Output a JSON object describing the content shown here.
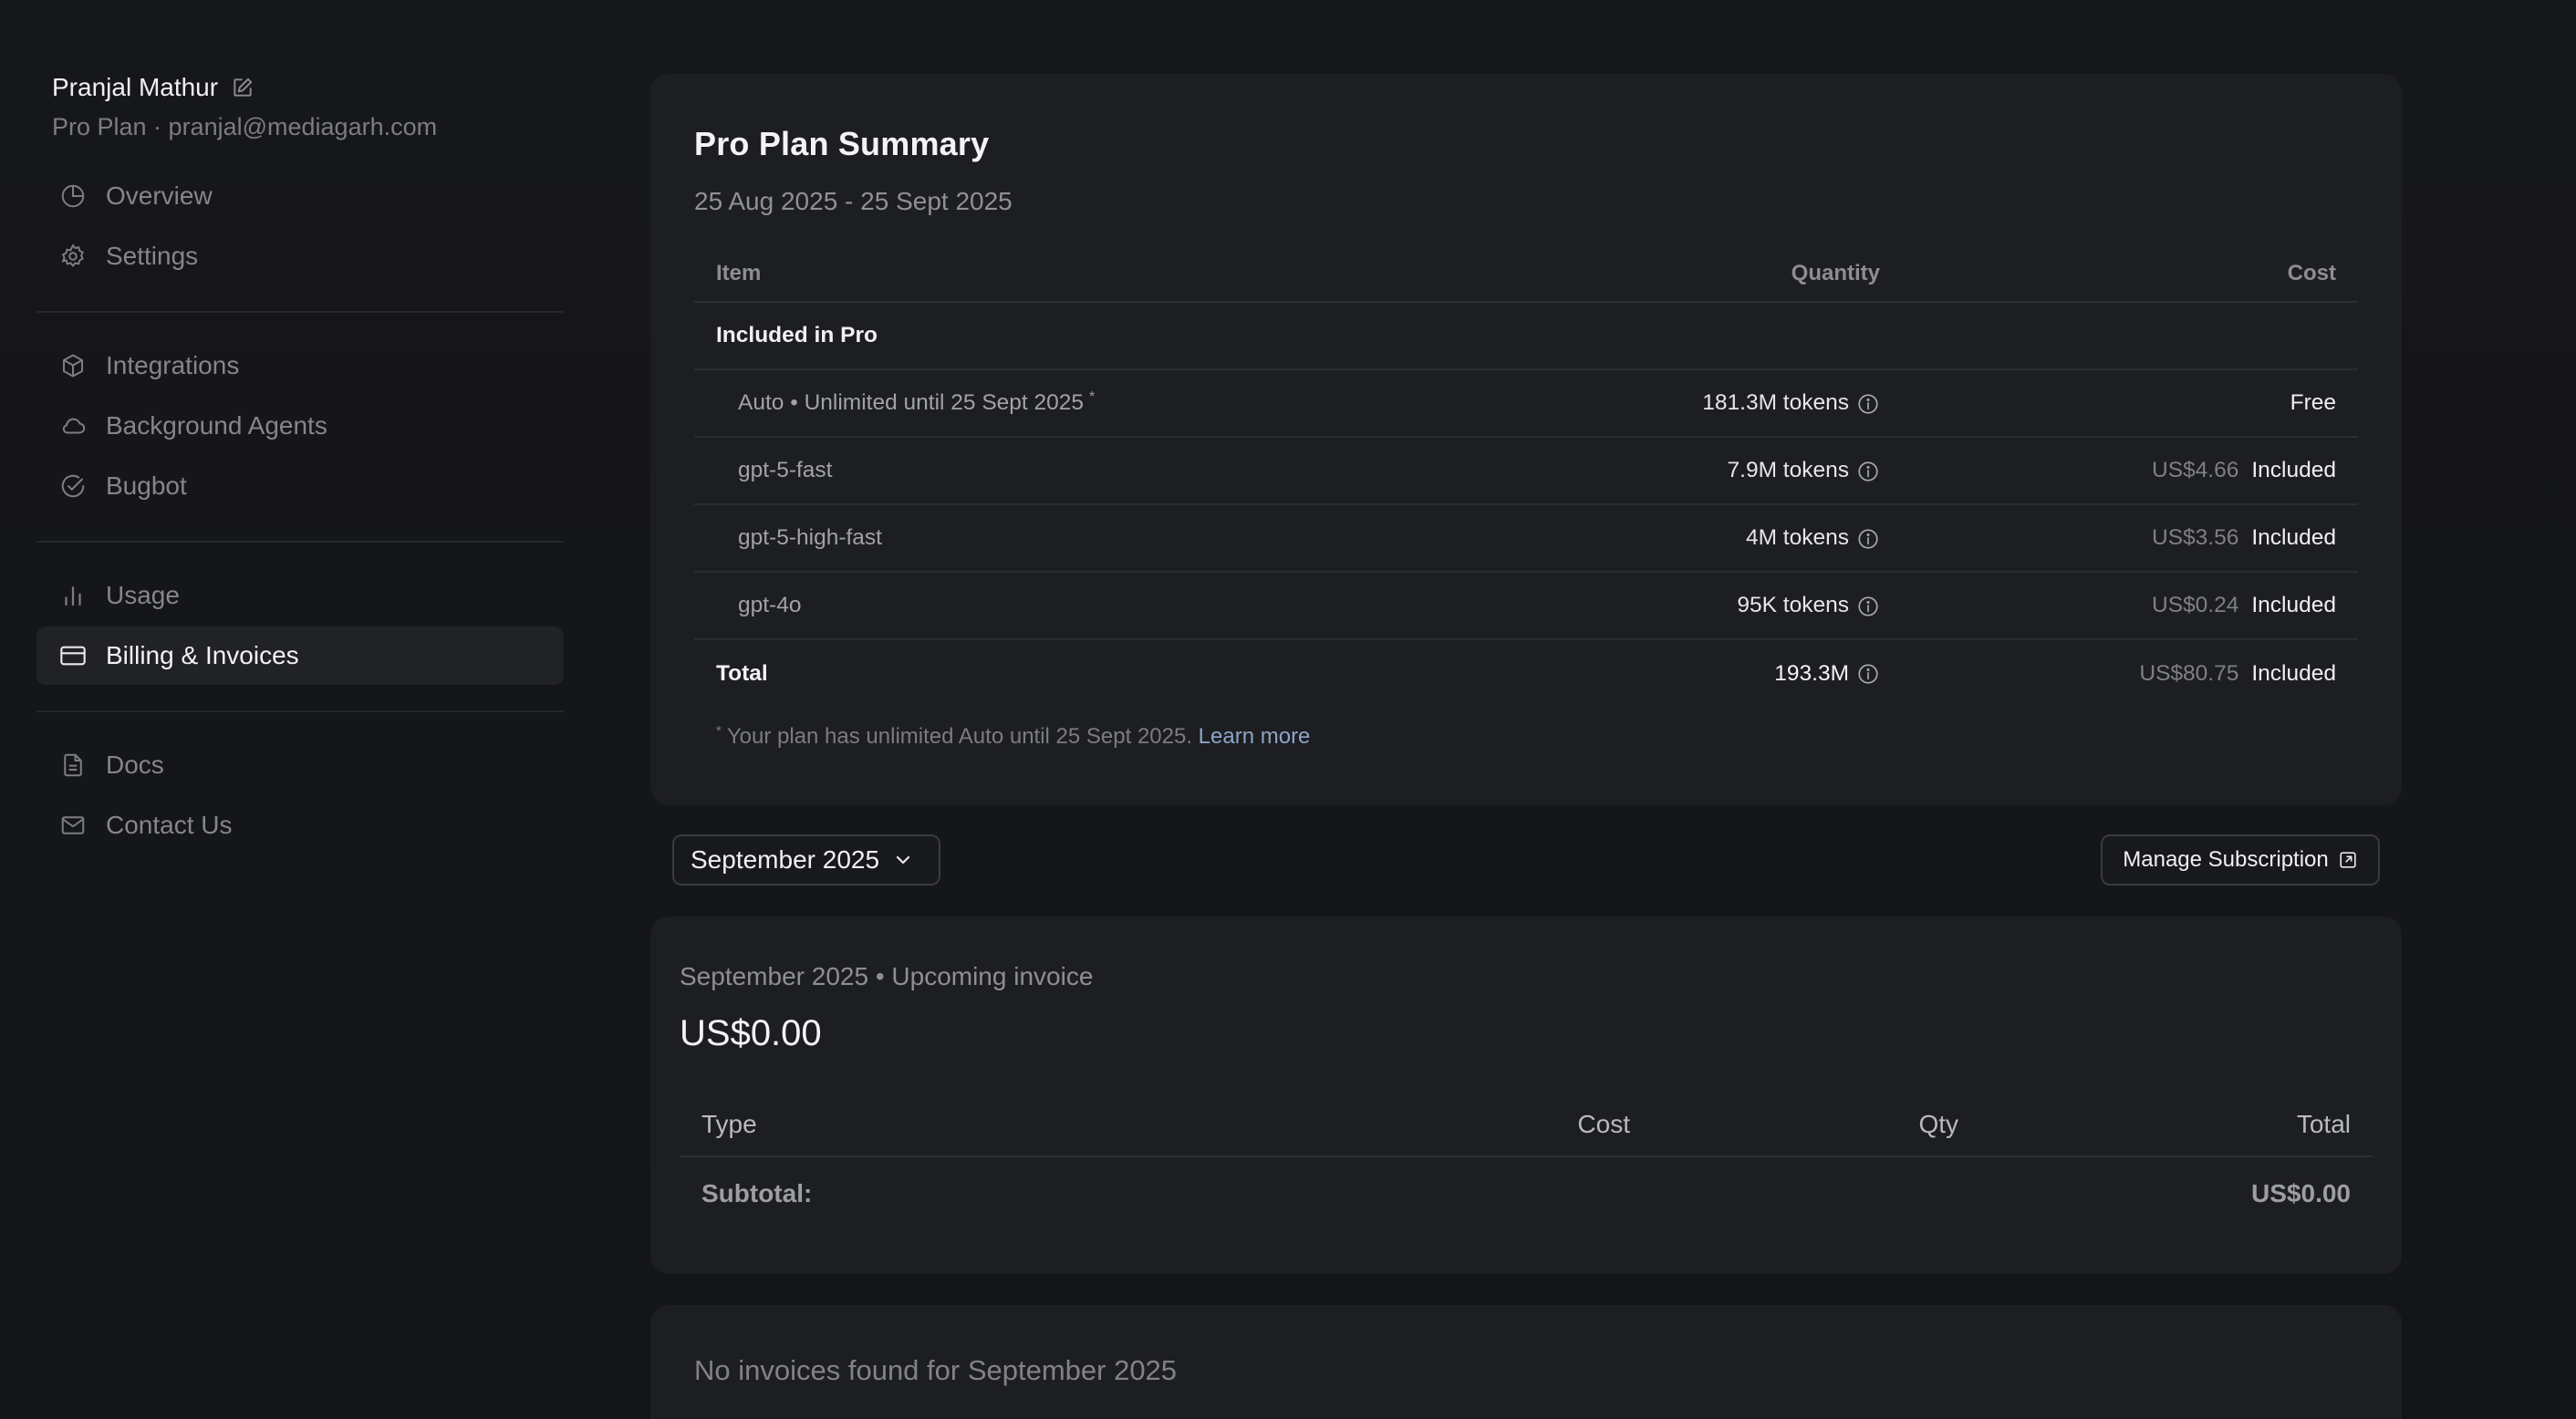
{
  "user": {
    "name": "Pranjal Mathur",
    "subtitle": "Pro Plan · pranjal@mediagarh.com"
  },
  "sidebar": {
    "groups": [
      [
        {
          "label": "Overview",
          "icon": "pie-chart-icon"
        },
        {
          "label": "Settings",
          "icon": "gear-icon"
        }
      ],
      [
        {
          "label": "Integrations",
          "icon": "cube-icon"
        },
        {
          "label": "Background Agents",
          "icon": "cloud-icon"
        },
        {
          "label": "Bugbot",
          "icon": "check-circle-icon"
        }
      ],
      [
        {
          "label": "Usage",
          "icon": "bar-chart-icon"
        },
        {
          "label": "Billing & Invoices",
          "icon": "credit-card-icon",
          "active": true
        }
      ],
      [
        {
          "label": "Docs",
          "icon": "document-icon"
        },
        {
          "label": "Contact Us",
          "icon": "mail-icon"
        }
      ]
    ]
  },
  "summary": {
    "title": "Pro Plan Summary",
    "range": "25 Aug 2025 - 25 Sept 2025",
    "columns": {
      "item": "Item",
      "quantity": "Quantity",
      "cost": "Cost"
    },
    "group_label": "Included in Pro",
    "rows": [
      {
        "item": "Auto • Unlimited until 25 Sept 2025",
        "star": "*",
        "quantity": "181.3M tokens",
        "cost": "",
        "status": "Free"
      },
      {
        "item": "gpt-5-fast",
        "quantity": "7.9M tokens",
        "cost": "US$4.66",
        "status": "Included"
      },
      {
        "item": "gpt-5-high-fast",
        "quantity": "4M tokens",
        "cost": "US$3.56",
        "status": "Included"
      },
      {
        "item": "gpt-4o",
        "quantity": "95K tokens",
        "cost": "US$0.24",
        "status": "Included"
      }
    ],
    "total": {
      "label": "Total",
      "quantity": "193.3M",
      "cost": "US$80.75",
      "status": "Included"
    },
    "footnote": {
      "star": "*",
      "text": "Your plan has unlimited Auto until 25 Sept 2025.",
      "link": "Learn more"
    }
  },
  "controls": {
    "month": "September 2025",
    "manage": "Manage Subscription"
  },
  "invoice": {
    "heading": "September 2025 • Upcoming invoice",
    "amount": "US$0.00",
    "columns": {
      "type": "Type",
      "cost": "Cost",
      "qty": "Qty",
      "total": "Total"
    },
    "subtotal_label": "Subtotal:",
    "subtotal_value": "US$0.00"
  },
  "no_invoices": "No invoices found for September 2025"
}
